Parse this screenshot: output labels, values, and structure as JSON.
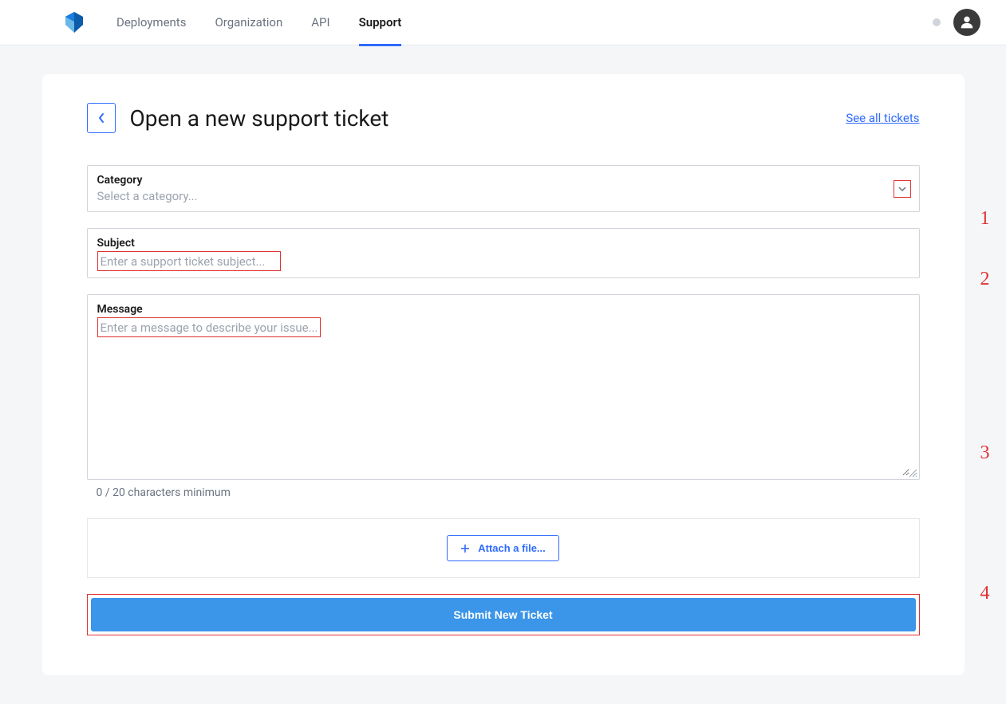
{
  "nav": {
    "items": [
      {
        "label": "Deployments"
      },
      {
        "label": "Organization"
      },
      {
        "label": "API"
      },
      {
        "label": "Support"
      }
    ]
  },
  "page": {
    "title": "Open a new support ticket",
    "see_all_link": "See all tickets"
  },
  "form": {
    "category": {
      "label": "Category",
      "placeholder": "Select a category..."
    },
    "subject": {
      "label": "Subject",
      "placeholder": "Enter a support ticket subject..."
    },
    "message": {
      "label": "Message",
      "placeholder": "Enter a message to describe your issue...",
      "char_count": "0 / 20 characters minimum"
    },
    "attach": {
      "label": "Attach a file..."
    },
    "submit": {
      "label": "Submit New Ticket"
    }
  },
  "annotations": {
    "a1": "1",
    "a2": "2",
    "a3": "3",
    "a4": "4"
  }
}
